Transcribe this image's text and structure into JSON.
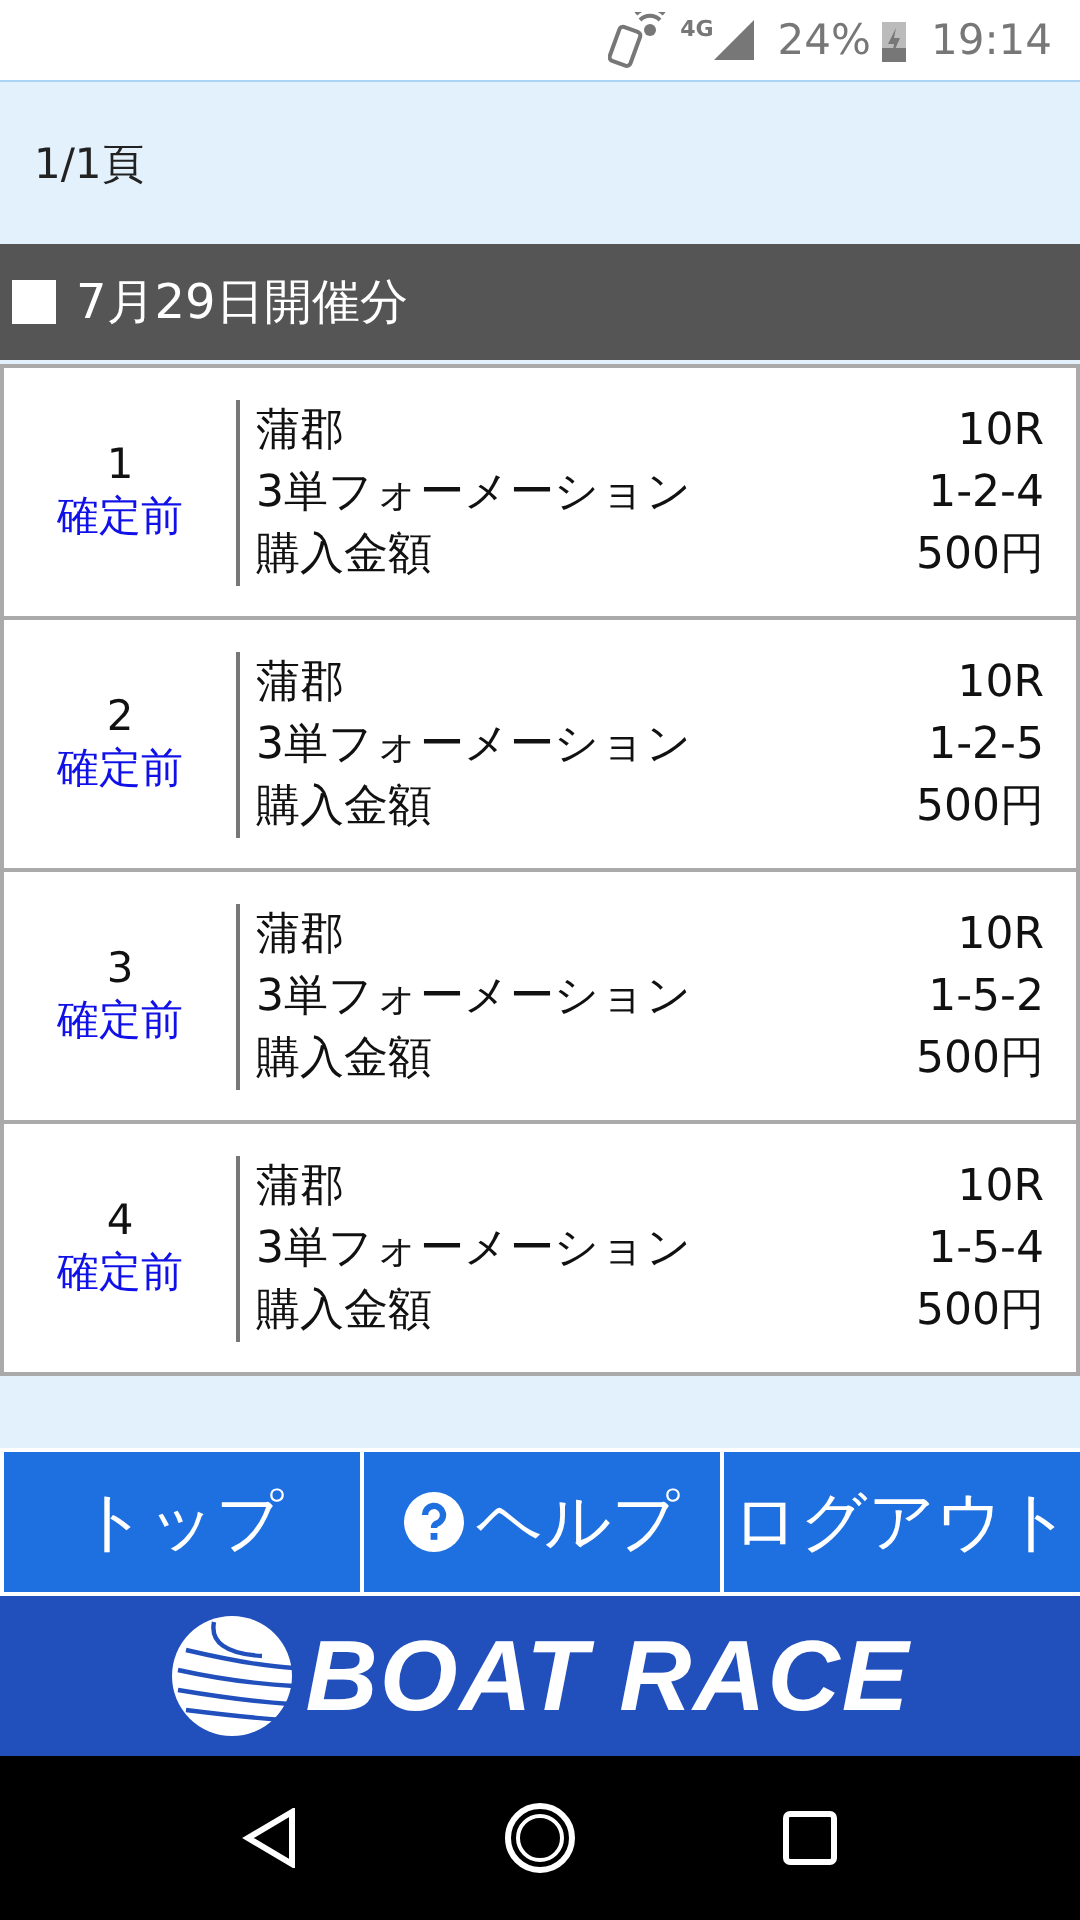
{
  "status_bar": {
    "network": "4G",
    "battery": "24%",
    "time": "19:14"
  },
  "page_indicator": "1/1頁",
  "section_title": "7月29日開催分",
  "bets": [
    {
      "number": "1",
      "status": "確定前",
      "venue": "蒲郡",
      "race": "10R",
      "bet_type": "3単フォーメーション",
      "combination": "1-2-4",
      "amount_label": "購入金額",
      "amount": "500円"
    },
    {
      "number": "2",
      "status": "確定前",
      "venue": "蒲郡",
      "race": "10R",
      "bet_type": "3単フォーメーション",
      "combination": "1-2-5",
      "amount_label": "購入金額",
      "amount": "500円"
    },
    {
      "number": "3",
      "status": "確定前",
      "venue": "蒲郡",
      "race": "10R",
      "bet_type": "3単フォーメーション",
      "combination": "1-5-2",
      "amount_label": "購入金額",
      "amount": "500円"
    },
    {
      "number": "4",
      "status": "確定前",
      "venue": "蒲郡",
      "race": "10R",
      "bet_type": "3単フォーメーション",
      "combination": "1-5-4",
      "amount_label": "購入金額",
      "amount": "500円"
    }
  ],
  "nav_buttons": [
    {
      "label": "トップ",
      "kind": "plain"
    },
    {
      "label": "ヘルプ",
      "kind": "help"
    },
    {
      "label": "ログアウト",
      "kind": "plain"
    }
  ],
  "footer_logo": "BOAT RACE"
}
